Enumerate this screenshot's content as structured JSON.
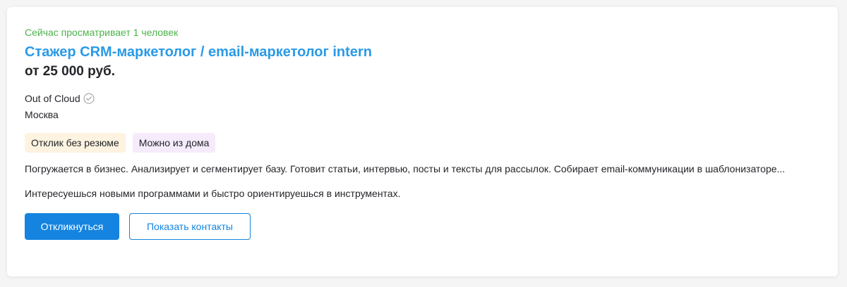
{
  "vacancy": {
    "viewers": "Сейчас просматривает 1 человек",
    "title": "Стажер CRM-маркетолог / email-маркетолог intern",
    "salary": "от 25 000 руб.",
    "company": "Out of Cloud",
    "city": "Москва",
    "tags": [
      {
        "label": "Отклик без резюме",
        "color": "#fdf3e0"
      },
      {
        "label": "Можно из дома",
        "color": "#f5ebfb"
      }
    ],
    "description": "Погружается в бизнес. Анализирует и сегментирует базу. Готовит статьи, интервью, посты и тексты для рассылок. Собирает email-коммуникации в шаблонизаторе...",
    "requirements": "Интересуешься новыми программами и быстро ориентируешься в инструментах.",
    "actions": {
      "respond_label": "Откликнуться",
      "contacts_label": "Показать контакты"
    }
  },
  "colors": {
    "accent": "#1484e0",
    "title_link": "#2a9ae6",
    "viewers_green": "#4bb34b"
  },
  "icons": {
    "verified": "check-circle-icon"
  }
}
